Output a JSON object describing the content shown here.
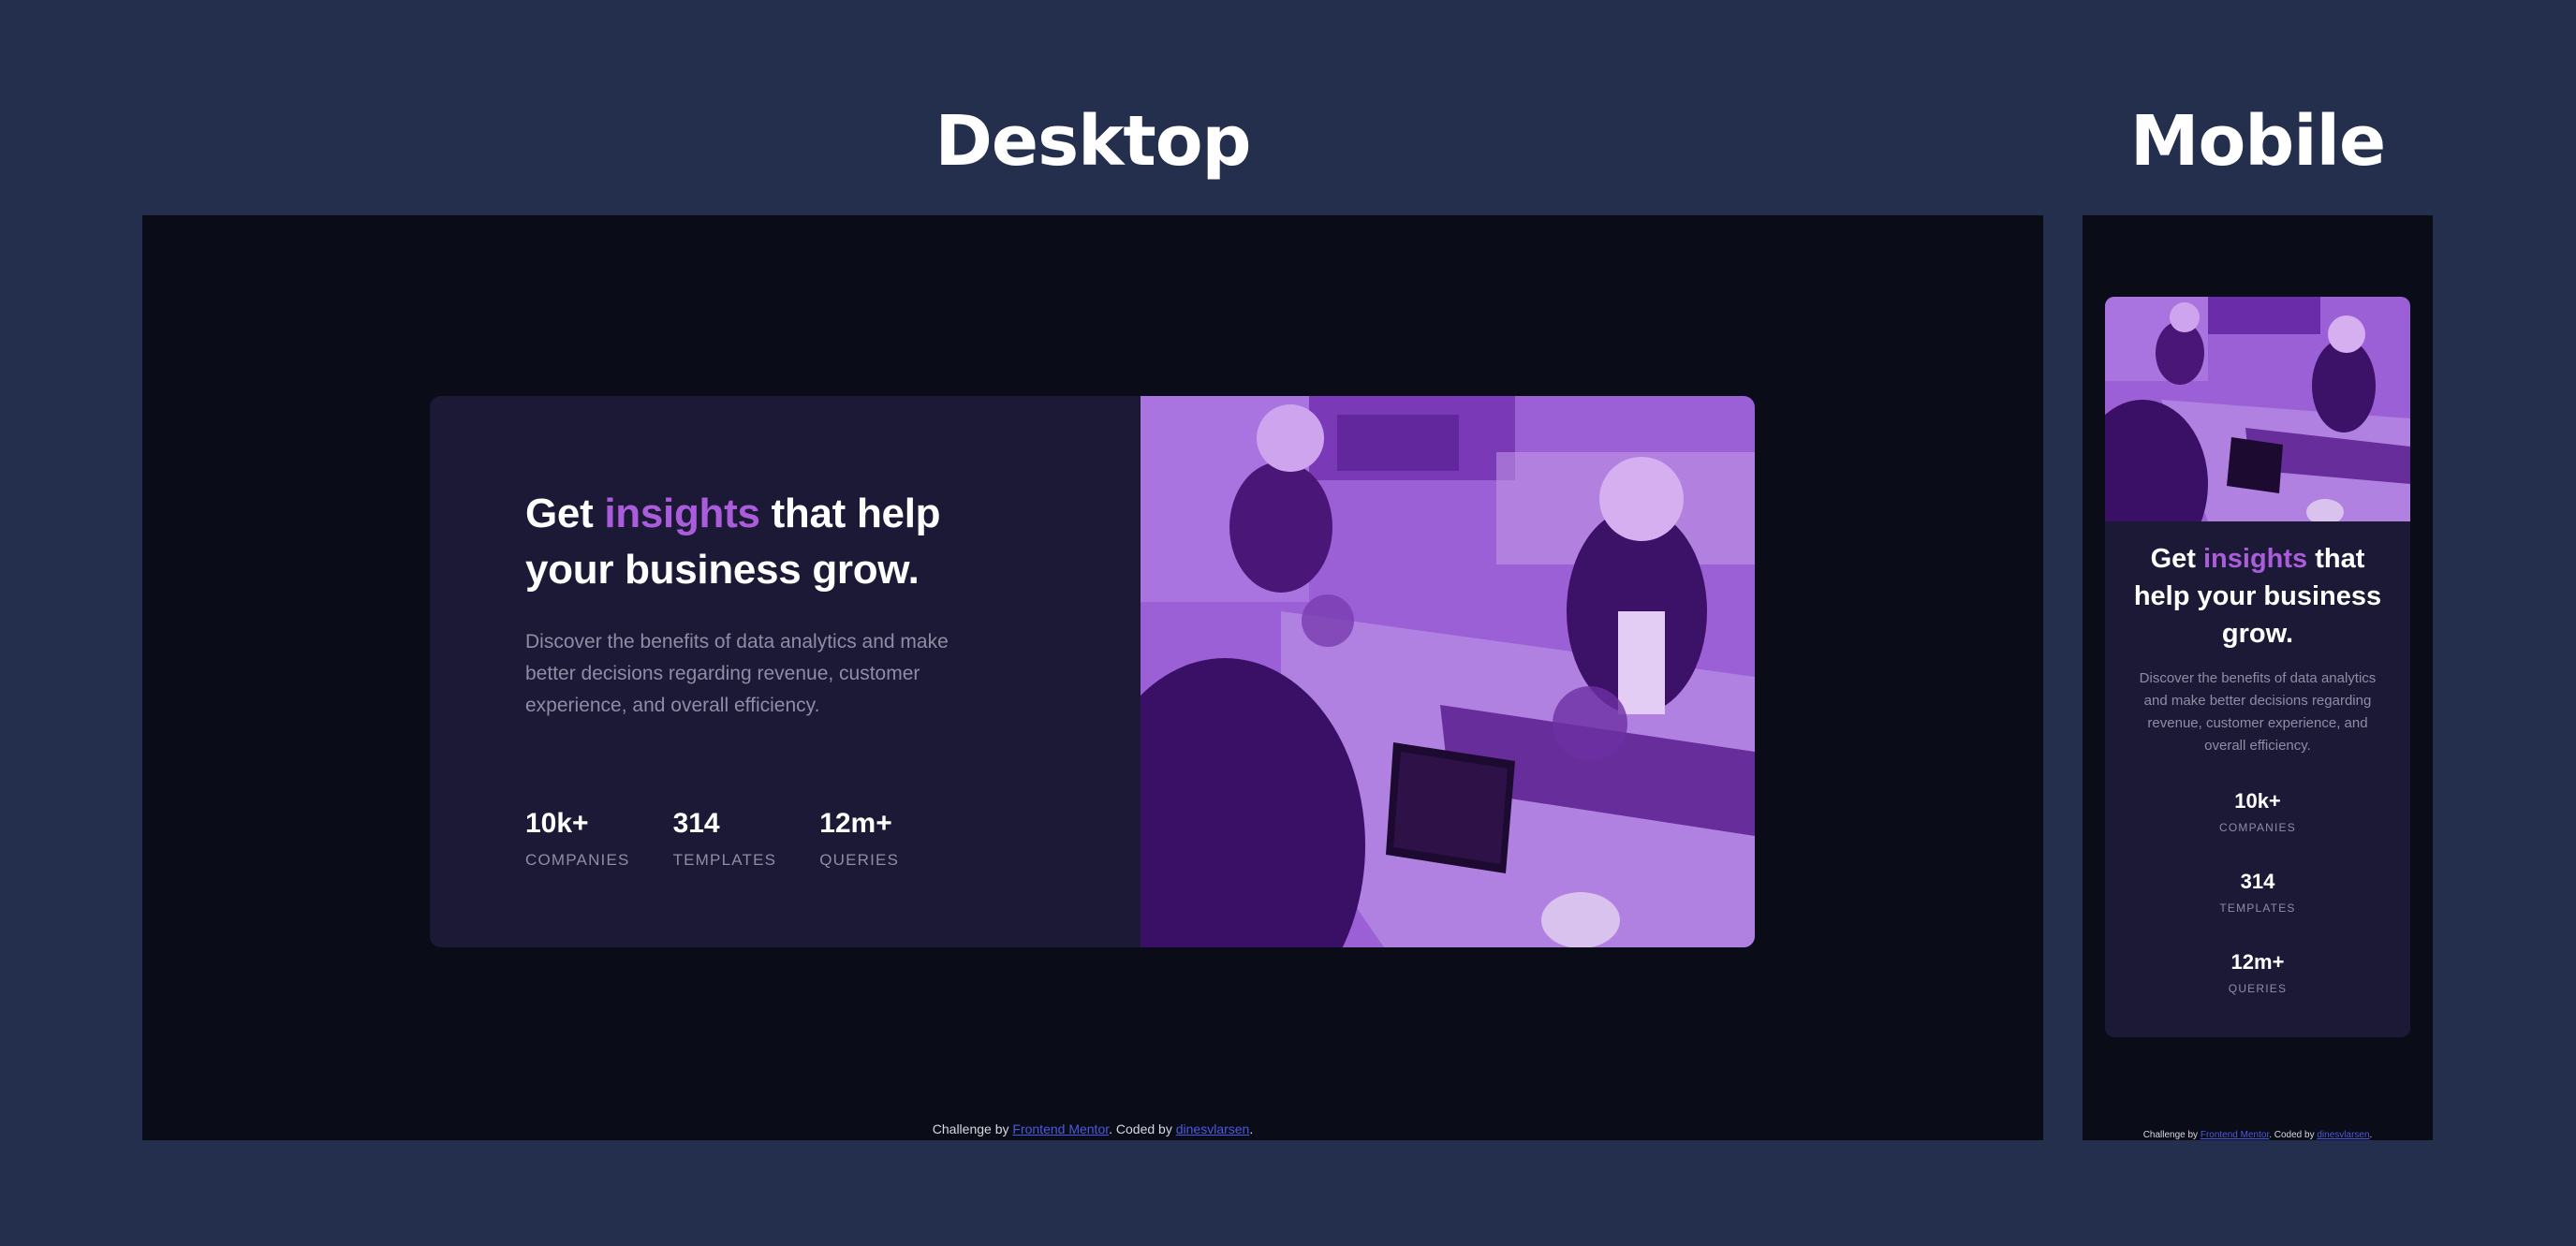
{
  "headings": {
    "desktop": "Desktop",
    "mobile": "Mobile"
  },
  "card": {
    "title_before": "Get ",
    "title_accent": "insights",
    "title_after": " that help your business grow.",
    "description": "Discover the benefits of data analytics and make better decisions regarding revenue, customer experience, and overall efficiency.",
    "stats": [
      {
        "value": "10k+",
        "label": "COMPANIES"
      },
      {
        "value": "314",
        "label": "TEMPLATES"
      },
      {
        "value": "12m+",
        "label": "QUERIES"
      }
    ]
  },
  "footer": {
    "prefix": "Challenge by ",
    "link1": "Frontend Mentor",
    "middle": ". Coded by ",
    "link2": "dinesvlarsen",
    "suffix": "."
  },
  "colors": {
    "page_bg": "#232f4c",
    "frame_bg": "#0a0c17",
    "card_bg": "#1c1937",
    "accent": "#aa5cdb",
    "muted_text": "#8f8ca3",
    "image_tint": "#9b5fd6"
  }
}
